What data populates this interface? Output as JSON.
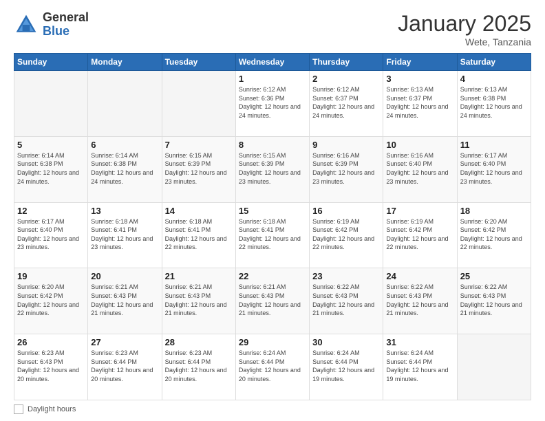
{
  "header": {
    "logo_general": "General",
    "logo_blue": "Blue",
    "month_title": "January 2025",
    "subtitle": "Wete, Tanzania"
  },
  "calendar": {
    "days_of_week": [
      "Sunday",
      "Monday",
      "Tuesday",
      "Wednesday",
      "Thursday",
      "Friday",
      "Saturday"
    ],
    "weeks": [
      [
        {
          "day": "",
          "sunrise": "",
          "sunset": "",
          "daylight": "",
          "empty": true
        },
        {
          "day": "",
          "sunrise": "",
          "sunset": "",
          "daylight": "",
          "empty": true
        },
        {
          "day": "",
          "sunrise": "",
          "sunset": "",
          "daylight": "",
          "empty": true
        },
        {
          "day": "1",
          "sunrise": "Sunrise: 6:12 AM",
          "sunset": "Sunset: 6:36 PM",
          "daylight": "Daylight: 12 hours and 24 minutes.",
          "empty": false
        },
        {
          "day": "2",
          "sunrise": "Sunrise: 6:12 AM",
          "sunset": "Sunset: 6:37 PM",
          "daylight": "Daylight: 12 hours and 24 minutes.",
          "empty": false
        },
        {
          "day": "3",
          "sunrise": "Sunrise: 6:13 AM",
          "sunset": "Sunset: 6:37 PM",
          "daylight": "Daylight: 12 hours and 24 minutes.",
          "empty": false
        },
        {
          "day": "4",
          "sunrise": "Sunrise: 6:13 AM",
          "sunset": "Sunset: 6:38 PM",
          "daylight": "Daylight: 12 hours and 24 minutes.",
          "empty": false
        }
      ],
      [
        {
          "day": "5",
          "sunrise": "Sunrise: 6:14 AM",
          "sunset": "Sunset: 6:38 PM",
          "daylight": "Daylight: 12 hours and 24 minutes.",
          "empty": false
        },
        {
          "day": "6",
          "sunrise": "Sunrise: 6:14 AM",
          "sunset": "Sunset: 6:38 PM",
          "daylight": "Daylight: 12 hours and 24 minutes.",
          "empty": false
        },
        {
          "day": "7",
          "sunrise": "Sunrise: 6:15 AM",
          "sunset": "Sunset: 6:39 PM",
          "daylight": "Daylight: 12 hours and 23 minutes.",
          "empty": false
        },
        {
          "day": "8",
          "sunrise": "Sunrise: 6:15 AM",
          "sunset": "Sunset: 6:39 PM",
          "daylight": "Daylight: 12 hours and 23 minutes.",
          "empty": false
        },
        {
          "day": "9",
          "sunrise": "Sunrise: 6:16 AM",
          "sunset": "Sunset: 6:39 PM",
          "daylight": "Daylight: 12 hours and 23 minutes.",
          "empty": false
        },
        {
          "day": "10",
          "sunrise": "Sunrise: 6:16 AM",
          "sunset": "Sunset: 6:40 PM",
          "daylight": "Daylight: 12 hours and 23 minutes.",
          "empty": false
        },
        {
          "day": "11",
          "sunrise": "Sunrise: 6:17 AM",
          "sunset": "Sunset: 6:40 PM",
          "daylight": "Daylight: 12 hours and 23 minutes.",
          "empty": false
        }
      ],
      [
        {
          "day": "12",
          "sunrise": "Sunrise: 6:17 AM",
          "sunset": "Sunset: 6:40 PM",
          "daylight": "Daylight: 12 hours and 23 minutes.",
          "empty": false
        },
        {
          "day": "13",
          "sunrise": "Sunrise: 6:18 AM",
          "sunset": "Sunset: 6:41 PM",
          "daylight": "Daylight: 12 hours and 23 minutes.",
          "empty": false
        },
        {
          "day": "14",
          "sunrise": "Sunrise: 6:18 AM",
          "sunset": "Sunset: 6:41 PM",
          "daylight": "Daylight: 12 hours and 22 minutes.",
          "empty": false
        },
        {
          "day": "15",
          "sunrise": "Sunrise: 6:18 AM",
          "sunset": "Sunset: 6:41 PM",
          "daylight": "Daylight: 12 hours and 22 minutes.",
          "empty": false
        },
        {
          "day": "16",
          "sunrise": "Sunrise: 6:19 AM",
          "sunset": "Sunset: 6:42 PM",
          "daylight": "Daylight: 12 hours and 22 minutes.",
          "empty": false
        },
        {
          "day": "17",
          "sunrise": "Sunrise: 6:19 AM",
          "sunset": "Sunset: 6:42 PM",
          "daylight": "Daylight: 12 hours and 22 minutes.",
          "empty": false
        },
        {
          "day": "18",
          "sunrise": "Sunrise: 6:20 AM",
          "sunset": "Sunset: 6:42 PM",
          "daylight": "Daylight: 12 hours and 22 minutes.",
          "empty": false
        }
      ],
      [
        {
          "day": "19",
          "sunrise": "Sunrise: 6:20 AM",
          "sunset": "Sunset: 6:42 PM",
          "daylight": "Daylight: 12 hours and 22 minutes.",
          "empty": false
        },
        {
          "day": "20",
          "sunrise": "Sunrise: 6:21 AM",
          "sunset": "Sunset: 6:43 PM",
          "daylight": "Daylight: 12 hours and 21 minutes.",
          "empty": false
        },
        {
          "day": "21",
          "sunrise": "Sunrise: 6:21 AM",
          "sunset": "Sunset: 6:43 PM",
          "daylight": "Daylight: 12 hours and 21 minutes.",
          "empty": false
        },
        {
          "day": "22",
          "sunrise": "Sunrise: 6:21 AM",
          "sunset": "Sunset: 6:43 PM",
          "daylight": "Daylight: 12 hours and 21 minutes.",
          "empty": false
        },
        {
          "day": "23",
          "sunrise": "Sunrise: 6:22 AM",
          "sunset": "Sunset: 6:43 PM",
          "daylight": "Daylight: 12 hours and 21 minutes.",
          "empty": false
        },
        {
          "day": "24",
          "sunrise": "Sunrise: 6:22 AM",
          "sunset": "Sunset: 6:43 PM",
          "daylight": "Daylight: 12 hours and 21 minutes.",
          "empty": false
        },
        {
          "day": "25",
          "sunrise": "Sunrise: 6:22 AM",
          "sunset": "Sunset: 6:43 PM",
          "daylight": "Daylight: 12 hours and 21 minutes.",
          "empty": false
        }
      ],
      [
        {
          "day": "26",
          "sunrise": "Sunrise: 6:23 AM",
          "sunset": "Sunset: 6:43 PM",
          "daylight": "Daylight: 12 hours and 20 minutes.",
          "empty": false
        },
        {
          "day": "27",
          "sunrise": "Sunrise: 6:23 AM",
          "sunset": "Sunset: 6:44 PM",
          "daylight": "Daylight: 12 hours and 20 minutes.",
          "empty": false
        },
        {
          "day": "28",
          "sunrise": "Sunrise: 6:23 AM",
          "sunset": "Sunset: 6:44 PM",
          "daylight": "Daylight: 12 hours and 20 minutes.",
          "empty": false
        },
        {
          "day": "29",
          "sunrise": "Sunrise: 6:24 AM",
          "sunset": "Sunset: 6:44 PM",
          "daylight": "Daylight: 12 hours and 20 minutes.",
          "empty": false
        },
        {
          "day": "30",
          "sunrise": "Sunrise: 6:24 AM",
          "sunset": "Sunset: 6:44 PM",
          "daylight": "Daylight: 12 hours and 19 minutes.",
          "empty": false
        },
        {
          "day": "31",
          "sunrise": "Sunrise: 6:24 AM",
          "sunset": "Sunset: 6:44 PM",
          "daylight": "Daylight: 12 hours and 19 minutes.",
          "empty": false
        },
        {
          "day": "",
          "sunrise": "",
          "sunset": "",
          "daylight": "",
          "empty": true
        }
      ]
    ]
  },
  "legend": {
    "label": "Daylight hours"
  }
}
